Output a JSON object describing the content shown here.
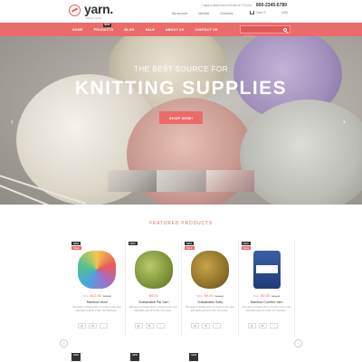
{
  "header": {
    "logo_text": "yarn.",
    "logo_tagline": "artisan yarns",
    "info": "7 days a week from 9:00 am to 7:00 pm",
    "phone": "800-2345-6789",
    "links": [
      "My account",
      "Wishlist",
      "Checkout"
    ],
    "cart": "Cart: 0",
    "currency": "USD"
  },
  "nav": {
    "items": [
      "HOME",
      "PRODUCTS",
      "BLOG",
      "SALE",
      "ABOUT US",
      "CONTACT US"
    ],
    "new_badge": "NEW",
    "search_placeholder": "SEARCH"
  },
  "hero": {
    "subtitle": "THE BEST SOURCE FOR",
    "title": "KNITTING SUPPLIES",
    "button": "SHOP NOW!",
    "prev": "‹",
    "next": "›"
  },
  "featured": {
    "title": "FEATURED PRODUCTS",
    "products": [
      {
        "new": "NEW",
        "sale": "SALE",
        "from": "from",
        "price": "$12.00",
        "old": "$15.00",
        "name": "Rainbow Wool",
        "desc": "We keep it vintage when it comes to the yarn that adds warmth to life. Our Rainbow... "
      },
      {
        "new": "NEW",
        "sale": "",
        "from": "",
        "price": "$9.00",
        "old": "",
        "name": "Sustainable Pal Yarn",
        "desc": "We keep it vintage when it comes to the yarn that adds warmth to life. Our wool... "
      },
      {
        "new": "NEW",
        "sale": "SALE",
        "from": "from",
        "price": "$9.00",
        "old": "$12.00",
        "name": "Sustainable Softy",
        "desc": "We keep it vintage when it comes to the yarn that adds warmth to life. Our softy... "
      },
      {
        "new": "NEW",
        "sale": "SALE",
        "from": "from",
        "price": "$9.00",
        "old": "$12.00",
        "name": "Bamboo Comfort Yarn",
        "desc": "We keep it vintage when it comes to the yarn that adds warmth to life. Our bamboo... "
      }
    ],
    "prev": "‹",
    "next": "›"
  },
  "colors": {
    "accent": "#ea6b6a",
    "dark": "#333333"
  }
}
